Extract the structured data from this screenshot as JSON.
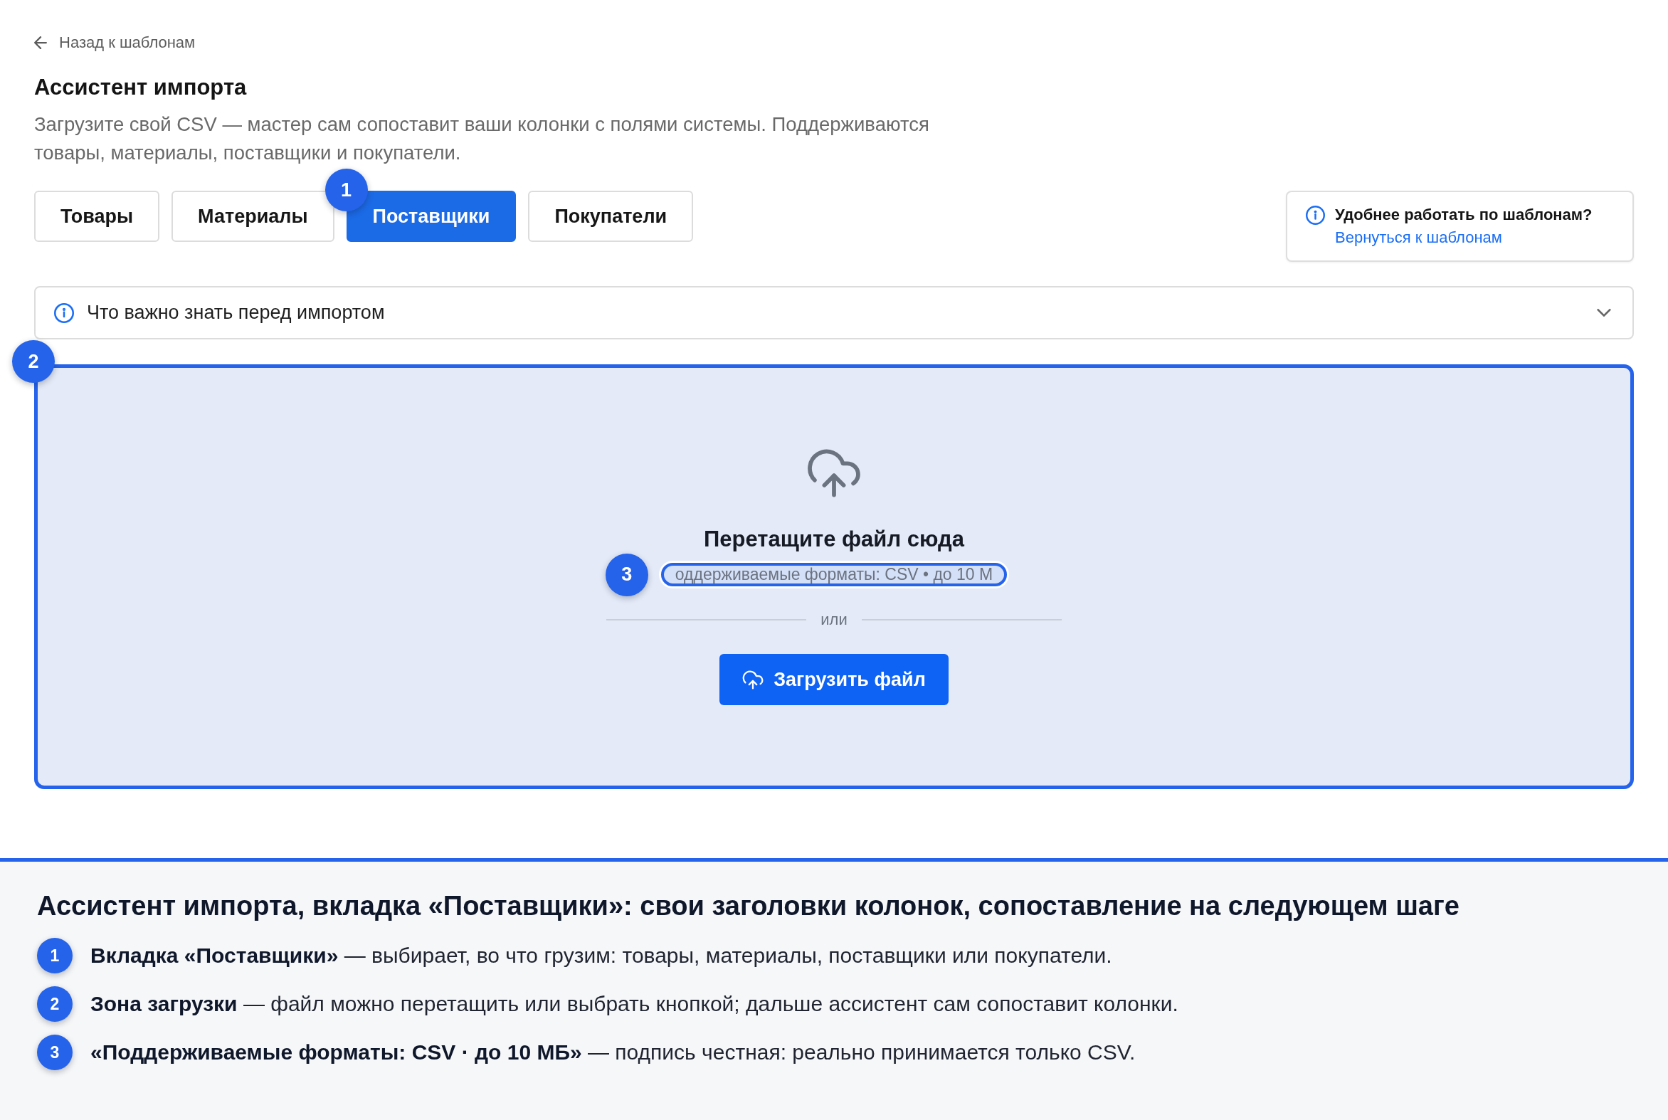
{
  "back_link": {
    "label": "Назад к шаблонам"
  },
  "page": {
    "title": "Ассистент импорта",
    "description": "Загрузите свой CSV — мастер сам сопоставит ваши колонки с полями системы. Поддерживаются товары, материалы, поставщики и покупатели."
  },
  "tabs": [
    {
      "label": "Товары",
      "selected": false
    },
    {
      "label": "Материалы",
      "selected": false
    },
    {
      "label": "Поставщики",
      "selected": true,
      "marker": "1"
    },
    {
      "label": "Покупатели",
      "selected": false
    }
  ],
  "template_hint": {
    "title": "Удобнее работать по шаблонам?",
    "link": "Вернуться к шаблонам"
  },
  "notice": {
    "label": "Что важно знать перед импортом",
    "expanded": false
  },
  "dropzone": {
    "marker": "2",
    "title": "Перетащите файл сюда",
    "formats": {
      "text": "оддерживаемые форматы: CSV • до 10 М",
      "highlighted": true,
      "marker": "3"
    },
    "separator": "или",
    "button": "Загрузить файл"
  },
  "caption": {
    "title": "Ассистент импорта, вкладка «Поставщики»: свои заголовки колонок, сопоставление на следующем шаге",
    "items": [
      {
        "number": "1",
        "text": "**Вкладка «Поставщики»** — выбирает, во что грузим: товары, материалы, поставщики или покупатели."
      },
      {
        "number": "2",
        "text": "**Зона загрузки** — файл можно перетащить или выбрать кнопкой; дальше ассистент сам сопоставит колонки."
      },
      {
        "number": "3",
        "text": "**«Поддерживаемые форматы: CSV · до 10 МБ»** — подпись честная: реально принимается только CSV."
      }
    ]
  }
}
